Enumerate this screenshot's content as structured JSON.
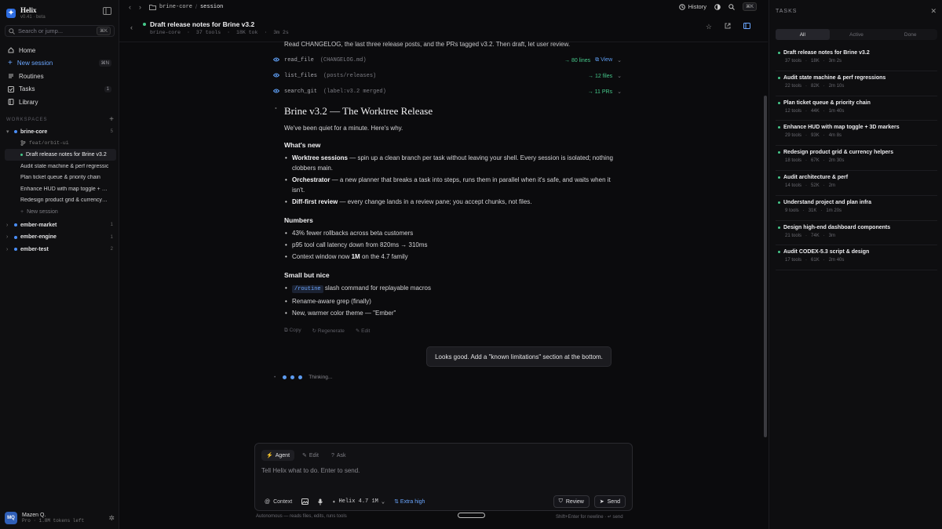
{
  "app": {
    "name": "Helix",
    "version": "v0.41 · beta"
  },
  "sidebar": {
    "search_placeholder": "Search or jump...",
    "search_kbd": "⌘K",
    "nav": [
      {
        "label": "Home",
        "badge": ""
      },
      {
        "label": "New session",
        "badge": "⌘N"
      },
      {
        "label": "Routines",
        "badge": ""
      },
      {
        "label": "Tasks",
        "badge": "1"
      },
      {
        "label": "Library",
        "badge": ""
      }
    ],
    "workspaces_label": "WORKSPACES",
    "workspaces": [
      {
        "name": "brine-core",
        "count": "5",
        "expanded": true,
        "branch": "feat/orbit-ui",
        "sessions": [
          "Draft release notes for Brine v3.2",
          "Audit state machine & perf regressions",
          "Plan ticket queue & priority chain",
          "Enhance HUD with map toggle + 3D markers",
          "Redesign product grid & currency helpers"
        ],
        "new_session": "New session"
      },
      {
        "name": "ember-market",
        "count": "1"
      },
      {
        "name": "ember-engine",
        "count": "1"
      },
      {
        "name": "ember-test",
        "count": "2"
      }
    ],
    "user": {
      "initials": "MQ",
      "name": "Mazen Q.",
      "plan": "Pro · 1.8M tokens left"
    }
  },
  "topbar": {
    "crumb_project": "brine-core",
    "crumb_sep": "/",
    "crumb_current": "session",
    "history": "History",
    "kbd": "⌘K"
  },
  "session": {
    "title": "Draft release notes for Brine v3.2",
    "meta": [
      "brine-core",
      "37 tools",
      "18K tok",
      "3m 2s"
    ]
  },
  "conversation": {
    "intro": "Read CHANGELOG, the last three release posts, and the PRs tagged v3.2. Then draft, let user review.",
    "tools": [
      {
        "name": "read_file",
        "arg": "(CHANGELOG.md)",
        "result": "→ 80 lines",
        "extra": "View"
      },
      {
        "name": "list_files",
        "arg": "(posts/releases)",
        "result": "→ 12 files",
        "extra": ""
      },
      {
        "name": "search_git",
        "arg": "(label:v3.2 merged)",
        "result": "→ 11 PRs",
        "extra": ""
      }
    ],
    "heading": "Brine v3.2 — The Worktree Release",
    "lede": "We've been quiet for a minute. Here's why.",
    "whats_new": "What's new",
    "new_items": [
      {
        "bold": "Worktree sessions",
        "text": " — spin up a clean branch per task without leaving your shell. Every session is isolated; nothing clobbers main."
      },
      {
        "bold": "Orchestrator",
        "text": " — a new planner that breaks a task into steps, runs them in parallel when it's safe, and waits when it isn't."
      },
      {
        "bold": "Diff-first review",
        "text": " — every change lands in a review pane; you accept chunks, not files."
      }
    ],
    "numbers": "Numbers",
    "number_items": [
      "43% fewer rollbacks across beta customers",
      "p95 tool call latency down from 820ms → 310ms"
    ],
    "context_pre": "Context window now ",
    "context_bold": "1M",
    "context_post": " on the 4.7 family",
    "small": "Small but nice",
    "routine_code": "/routine",
    "routine_text": " slash command for replayable macros",
    "small_items": [
      "Rename-aware grep (finally)",
      "New, warmer color theme — \"Ember\""
    ],
    "actions": [
      "Copy",
      "Regenerate",
      "Edit"
    ],
    "user_message": "Looks good. Add a \"known limitations\" section at the bottom.",
    "thinking": "Thinking..."
  },
  "composer": {
    "modes": [
      "Agent",
      "Edit",
      "Ask"
    ],
    "placeholder": "Tell Helix what to do. Enter to send.",
    "context": "Context",
    "model": "Helix 4.7 1M",
    "effort": "Extra high",
    "review": "Review",
    "send": "Send",
    "footer_left": "Autonomous — reads files, edits, runs tools",
    "footer_right": "Shift+Enter for newline · ↵ send"
  },
  "tasks": {
    "title": "TASKS",
    "filters": [
      "All",
      "Active",
      "Done"
    ],
    "items": [
      {
        "title": "Draft release notes for Brine v3.2",
        "tools": "37 tools",
        "tok": "18K",
        "time": "3m 2s",
        "color": "#46c98b"
      },
      {
        "title": "Audit state machine & perf regressions",
        "tools": "22 tools",
        "tok": "82K",
        "time": "2m 10s",
        "color": "#46c98b"
      },
      {
        "title": "Plan ticket queue & priority chain",
        "tools": "12 tools",
        "tok": "44K",
        "time": "1m 40s",
        "color": "#46c98b"
      },
      {
        "title": "Enhance HUD with map toggle + 3D markers",
        "tools": "29 tools",
        "tok": "93K",
        "time": "4m 8s",
        "color": "#46c98b"
      },
      {
        "title": "Redesign product grid & currency helpers",
        "tools": "18 tools",
        "tok": "67K",
        "time": "2m 30s",
        "color": "#46c98b"
      },
      {
        "title": "Audit architecture & perf",
        "tools": "14 tools",
        "tok": "52K",
        "time": "2m",
        "color": "#46c98b"
      },
      {
        "title": "Understand project and plan infra",
        "tools": "9 tools",
        "tok": "31K",
        "time": "1m 20s",
        "color": "#46c98b"
      },
      {
        "title": "Design high-end dashboard components",
        "tools": "21 tools",
        "tok": "74K",
        "time": "3m",
        "color": "#46c98b"
      },
      {
        "title": "Audit CODEX-5.3 script & design",
        "tools": "17 tools",
        "tok": "61K",
        "time": "2m 40s",
        "color": "#46c98b"
      }
    ]
  }
}
